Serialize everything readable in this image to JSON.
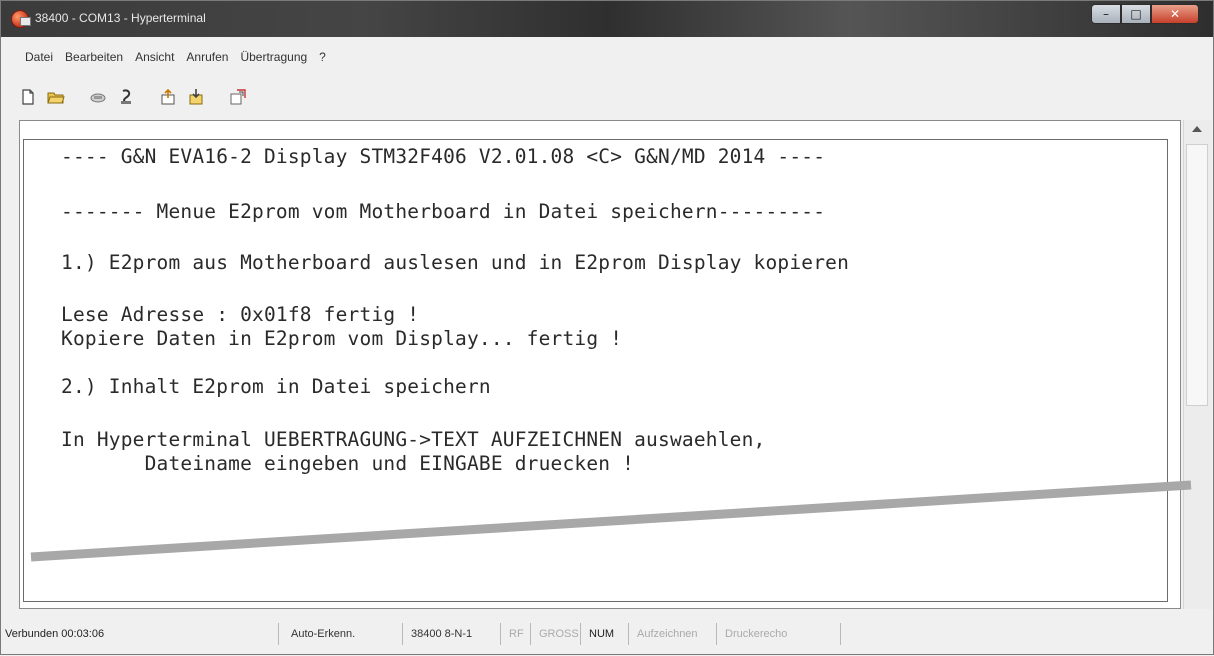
{
  "window": {
    "title": "38400 - COM13 - Hyperterminal"
  },
  "menu": {
    "items": [
      "Datei",
      "Bearbeiten",
      "Ansicht",
      "Anrufen",
      "Übertragung",
      "?"
    ]
  },
  "toolbar": {
    "icons": [
      "new-document-icon",
      "open-folder-icon",
      "connect-phone-icon",
      "disconnect-phone-icon",
      "send-icon",
      "receive-icon",
      "properties-icon"
    ]
  },
  "terminal": {
    "lines": [
      "---- G&N EVA16-2 Display STM32F406 V2.01.08 <C> G&N/MD 2014 ----",
      "------- Menue E2prom vom Motherboard in Datei speichern---------",
      "1.) E2prom aus Motherboard auslesen und in E2prom Display kopieren",
      "Lese Adresse : 0x01f8 fertig !",
      "Kopiere Daten in E2prom vom Display... fertig !",
      "2.) Inhalt E2prom in Datei speichern",
      "In Hyperterminal UEBERTRAGUNG->TEXT AUFZEICHNEN auswaehlen,",
      "       Dateiname eingeben und EINGABE druecken !"
    ]
  },
  "status": {
    "connected": "Verbunden 00:03:06",
    "detect": "Auto-Erkenn.",
    "port_settings": "38400 8-N-1",
    "rf": "RF",
    "caps": "GROSS",
    "num": "NUM",
    "capture": "Aufzeichnen",
    "print_echo": "Druckerecho"
  },
  "colors": {
    "titlebar": "#3b3b3b",
    "terminal_bg": "#ffffff",
    "terminal_text": "#2a2a2a",
    "overlay_line": "#a8a8a8"
  }
}
